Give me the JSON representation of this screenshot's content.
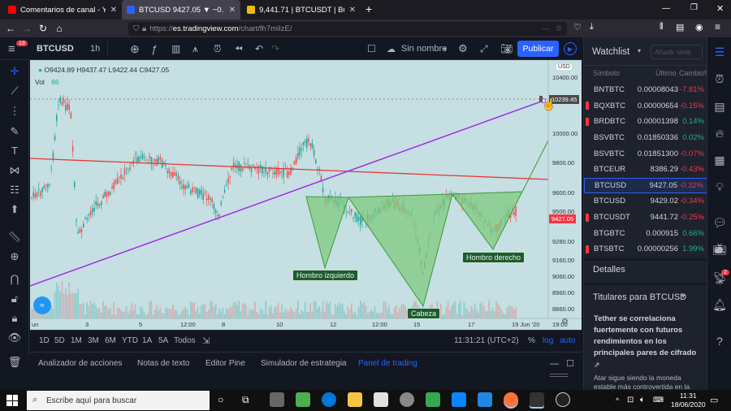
{
  "browser": {
    "tabs": [
      {
        "title": "Comentarios de canal - YouTub",
        "color": "#ff0000"
      },
      {
        "title": "BTCUSD 9427.05 ▼ −0.32% Sin n",
        "color": "#2962ff"
      },
      {
        "title": "9,441.71 | BTCUSDT | Buy Bitcoi",
        "color": "#f0b90b"
      }
    ],
    "url_prefix": "https://",
    "url_domain": "es.tradingview.com",
    "url_path": "/chart/fh7miIzE/"
  },
  "toolbar": {
    "notification_count": "13",
    "symbol": "BTCUSD",
    "interval": "1h",
    "layout_name": "Sin nombre",
    "publish_label": "Publicar"
  },
  "chart": {
    "ohlc": {
      "o": "O9424.89",
      "h": "H9437.47",
      "l": "L9422.44",
      "c": "C9427.05"
    },
    "vol_label": "Vol",
    "vol_value": "86",
    "currency": "USD",
    "price_ticks": [
      "10400.00",
      "10000.00",
      "9800.00",
      "9600.00",
      "9500.00",
      "9280.00",
      "9160.00",
      "9060.00",
      "8960.00",
      "8860.00"
    ],
    "cursor_price": "10239.45",
    "last_price": "9427.05",
    "time_ticks": [
      "un",
      "3",
      "5",
      "12:00",
      "8",
      "10",
      "12",
      "12:00",
      "15",
      "17",
      "19 Jun '20",
      "19:00"
    ],
    "annotations": {
      "left_shoulder": "Hombro izquierdo",
      "head": "Cabeza",
      "right_shoulder": "Hombro derecho"
    }
  },
  "bottombar": {
    "ranges": [
      "1D",
      "5D",
      "1M",
      "3M",
      "6M",
      "YTD",
      "1A",
      "5A",
      "Todos"
    ],
    "clock": "11:31:21 (UTC+2)",
    "pct": "%",
    "log": "log",
    "auto": "auto"
  },
  "panel_tabs": [
    "Analizador de acciones",
    "Notas de texto",
    "Editor Pine",
    "Simulador de estrategia",
    "Panel de trading"
  ],
  "watchlist": {
    "title": "Watchlist",
    "add_placeholder": "Añadir simb",
    "col_symbol": "Símbolo",
    "col_last": "Último",
    "col_change": "Cambio%",
    "rows": [
      {
        "sym": "BNTBTC",
        "last": "0.00008043",
        "chg": "-7.81%",
        "up": false,
        "flag": ""
      },
      {
        "sym": "BQXBTC",
        "last": "0.00000654",
        "chg": "-0.15%",
        "up": false,
        "flag": "#f23645"
      },
      {
        "sym": "BRDBTC",
        "last": "0.00001398",
        "chg": "0.14%",
        "up": true,
        "flag": "#f23645"
      },
      {
        "sym": "BSVBTC",
        "last": "0.01850336",
        "chg": "0.02%",
        "up": true,
        "flag": ""
      },
      {
        "sym": "BSVBTC",
        "last": "0.01851300",
        "chg": "-0.07%",
        "up": false,
        "flag": ""
      },
      {
        "sym": "BTCEUR",
        "last": "8386.29",
        "chg": "-0.43%",
        "up": false,
        "flag": ""
      },
      {
        "sym": "BTCUSD",
        "last": "9427.05",
        "chg": "-0.32%",
        "up": false,
        "flag": ""
      },
      {
        "sym": "BTCUSD",
        "last": "9429.02",
        "chg": "-0.34%",
        "up": false,
        "flag": ""
      },
      {
        "sym": "BTCUSDT",
        "last": "9441.72",
        "chg": "-0.25%",
        "up": false,
        "flag": "#f23645"
      },
      {
        "sym": "BTGBTC",
        "last": "0.000915",
        "chg": "0.66%",
        "up": true,
        "flag": ""
      },
      {
        "sym": "BTSBTC",
        "last": "0.00000256",
        "chg": "1.99%",
        "up": true,
        "flag": "#f23645"
      }
    ],
    "details_label": "Detalles",
    "news_title": "Titulares para BTCUSD",
    "news_headline": "Tether se correlaciona fuertemente con futuros rendimientos en los principales pares de cifrado",
    "news_snippet": "Atar sigue siendo la moneda estable más controvertida en la"
  },
  "right_badge": "2",
  "taskbar": {
    "search_placeholder": "Escribe aquí para buscar",
    "time": "11:31",
    "date": "18/06/2020"
  }
}
